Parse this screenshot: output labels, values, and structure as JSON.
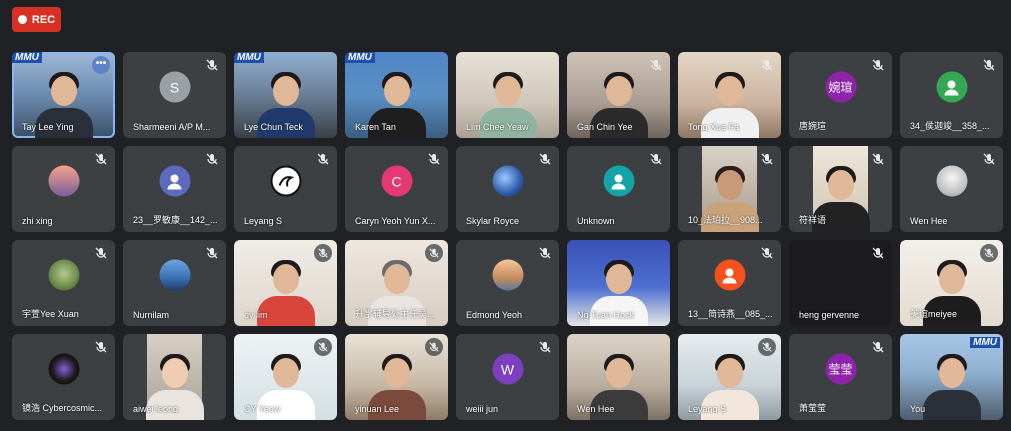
{
  "recording": {
    "label": "REC"
  },
  "participants": [
    {
      "name": "Tay Lee Ying",
      "kind": "video",
      "active": true
    },
    {
      "name": "Sharmeeni A/P M...",
      "kind": "avatar",
      "initial": "S",
      "color": "#9aa0a6"
    },
    {
      "name": "Lye Chun Teck",
      "kind": "video"
    },
    {
      "name": "Karen Tan",
      "kind": "video"
    },
    {
      "name": "Lim Chee Yeaw",
      "kind": "video"
    },
    {
      "name": "Gan Chin Yee",
      "kind": "video"
    },
    {
      "name": "Tong Xue Fa",
      "kind": "video"
    },
    {
      "name": "唐婉瑄",
      "kind": "avatar",
      "initial": "婉瑄",
      "color": "#8e24aa"
    },
    {
      "name": "34_侯迦竣__358_...",
      "kind": "avatar",
      "initial": "person",
      "color": "#34a853"
    },
    {
      "name": "zhi xing",
      "kind": "avatar",
      "initial": "",
      "color": "#c07060"
    },
    {
      "name": "23__罗敏康__142_...",
      "kind": "avatar",
      "initial": "person",
      "color": "#5c6bc0"
    },
    {
      "name": "Leyang S",
      "kind": "avatar",
      "initial": "",
      "color": "#ffffff"
    },
    {
      "name": "Caryn Yeoh Yun X...",
      "kind": "avatar",
      "initial": "C",
      "color": "#e53973"
    },
    {
      "name": "Skylar Royce",
      "kind": "avatar",
      "initial": "",
      "color": "#2d5ba8"
    },
    {
      "name": "Unknown",
      "kind": "avatar",
      "initial": "person",
      "color": "#12a4a8"
    },
    {
      "name": "10_法珀拉__908...",
      "kind": "video"
    },
    {
      "name": "符祥语",
      "kind": "video"
    },
    {
      "name": "Wen Hee",
      "kind": "avatar",
      "initial": "",
      "color": "#d7d7d7"
    },
    {
      "name": "宇萱Yee Xuan",
      "kind": "avatar",
      "initial": "",
      "color": "#6b8a4a"
    },
    {
      "name": "Nurnilam",
      "kind": "avatar",
      "initial": "",
      "color": "#3a6fb3"
    },
    {
      "name": "qy lim",
      "kind": "video"
    },
    {
      "name": "升学辅导处主任吴...",
      "kind": "video"
    },
    {
      "name": "Edmond Yeoh",
      "kind": "avatar",
      "initial": "",
      "color": "#c58a5e"
    },
    {
      "name": "Ng Tuan Hock",
      "kind": "video"
    },
    {
      "name": "13__简诗燕__085_...",
      "kind": "avatar",
      "initial": "person",
      "color": "#f4511e"
    },
    {
      "name": "heng gervenne",
      "kind": "dark"
    },
    {
      "name": "美谊meiyee",
      "kind": "video"
    },
    {
      "name": "镜浩 Cybercosmic...",
      "kind": "avatar",
      "initial": "",
      "color": "#111111"
    },
    {
      "name": "aiwei leong",
      "kind": "video"
    },
    {
      "name": "CY Yeow",
      "kind": "video"
    },
    {
      "name": "yinuan Lee",
      "kind": "video"
    },
    {
      "name": "weiii jun",
      "kind": "avatar",
      "initial": "W",
      "color": "#7b3fbf"
    },
    {
      "name": "Wen Hee",
      "kind": "video"
    },
    {
      "name": "Leyang S",
      "kind": "video"
    },
    {
      "name": "萧莹莹",
      "kind": "avatar",
      "initial": "莹莹",
      "color": "#8e24aa"
    },
    {
      "name": "You",
      "kind": "video"
    }
  ],
  "icons": {
    "mic_muted": "mic-off-icon",
    "more": "more-options-icon",
    "rec_dot": "record-dot-icon"
  },
  "colors": {
    "background": "#202124",
    "tile": "#3c4043",
    "rec": "#d93025",
    "active_border": "#8ab4f8"
  }
}
